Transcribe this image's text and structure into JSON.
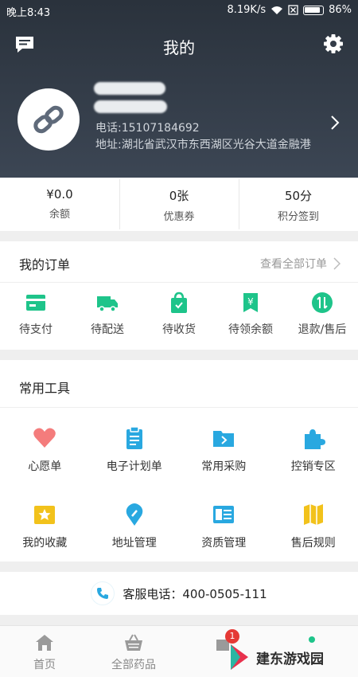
{
  "status_bar": {
    "time": "晚上8:43",
    "speed": "8.19K/s",
    "battery": "86%"
  },
  "header": {
    "title": "我的"
  },
  "profile": {
    "phone": "电话:15107184692",
    "address": "地址:湖北省武汉市东西湖区光谷大道金融港"
  },
  "stats": [
    {
      "value": "¥0.0",
      "label": "余额"
    },
    {
      "value": "0张",
      "label": "优惠券"
    },
    {
      "value": "50分",
      "label": "积分签到"
    }
  ],
  "orders": {
    "title": "我的订单",
    "view_all": "查看全部订单",
    "items": [
      {
        "label": "待支付",
        "icon": "card-icon"
      },
      {
        "label": "待配送",
        "icon": "truck-icon"
      },
      {
        "label": "待收货",
        "icon": "bag-icon"
      },
      {
        "label": "待领余额",
        "icon": "yen-icon"
      },
      {
        "label": "退款/售后",
        "icon": "refund-icon"
      }
    ]
  },
  "tools": {
    "title": "常用工具",
    "items": [
      {
        "label": "心愿单",
        "icon": "heart-icon"
      },
      {
        "label": "电子计划单",
        "icon": "clipboard-icon"
      },
      {
        "label": "常用采购",
        "icon": "folder-icon"
      },
      {
        "label": "控销专区",
        "icon": "puzzle-icon"
      },
      {
        "label": "我的收藏",
        "icon": "star-icon"
      },
      {
        "label": "地址管理",
        "icon": "location-icon"
      },
      {
        "label": "资质管理",
        "icon": "certificate-icon"
      },
      {
        "label": "售后规则",
        "icon": "map-icon"
      }
    ]
  },
  "service": {
    "text": "客服电话：400-0505-111"
  },
  "bottom_nav": [
    {
      "label": "首页",
      "icon": "home-icon"
    },
    {
      "label": "全部药品",
      "icon": "basket-icon"
    }
  ],
  "cart_badge": "1",
  "watermark": "建东游戏园",
  "colors": {
    "accent": "#1ec48a",
    "header": "#2f3843",
    "blue": "#29a8e0",
    "yellow": "#f2c21b",
    "pink": "#f47c7c"
  }
}
